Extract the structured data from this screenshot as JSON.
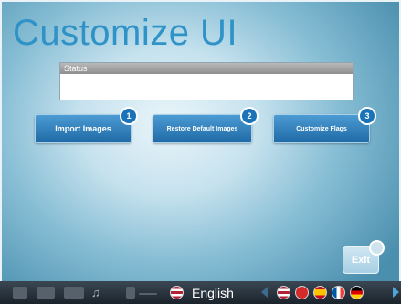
{
  "title": "Customize UI",
  "status": {
    "header": "Status",
    "message": ""
  },
  "buttons": [
    {
      "label": "Import Images",
      "number": "1"
    },
    {
      "label": "Restore Default Images",
      "number": "2"
    },
    {
      "label": "Customize Flags",
      "number": "3"
    }
  ],
  "exit_label": "Exit",
  "taskbar": {
    "language": "English",
    "icons": [
      "grid-icon",
      "grid-icon",
      "window-icon",
      "music-icon",
      "usb-icon",
      "dash-icon"
    ],
    "flags": [
      "us-flag-icon",
      "red-flag-icon",
      "spain-flag-icon",
      "france-flag-icon",
      "germany-flag-icon"
    ]
  },
  "colors": {
    "title": "#2f93c8",
    "button": "#1f6aa6",
    "taskbar": "#1b232b"
  }
}
